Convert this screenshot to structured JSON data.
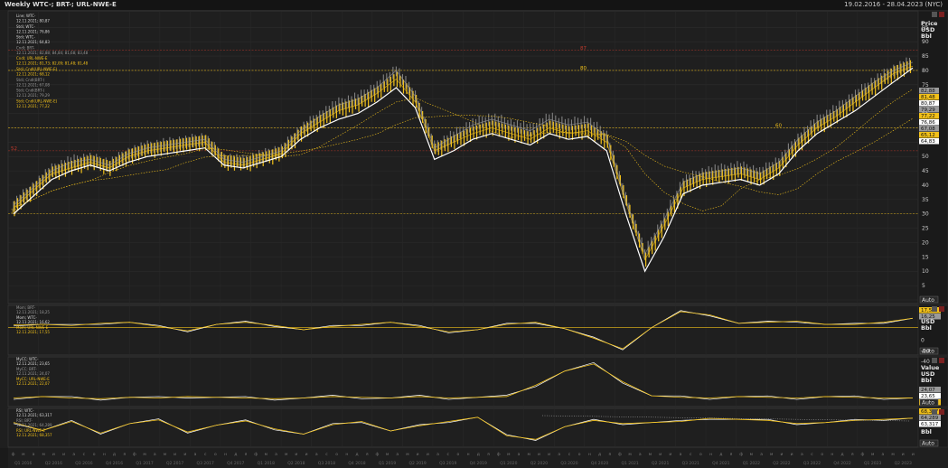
{
  "window": {
    "title": "Weekly WTC-; BRT-; URL-NWE-E",
    "date_range": "19.02.2016 - 28.04.2023 (NYC)"
  },
  "colors": {
    "white_series": "#ffffff",
    "yellow_series": "#f2c11a",
    "gray_series": "#9a9a9a",
    "red_line": "#c0392b",
    "bg": "#1f1f1f"
  },
  "toolbar": {
    "auto_label": "Auto",
    "close_icon": "close-icon",
    "settings_icon": "gear-icon"
  },
  "panels": {
    "price": {
      "header": [
        "Price",
        "USD",
        "Bbl"
      ],
      "legend": [
        {
          "name": "Line; WTC-",
          "date": "12.11.2021; 80,87",
          "color": "white"
        },
        {
          "name": "Stdi; WTC-",
          "date": "12.11.2021; 76,86",
          "color": "white"
        },
        {
          "name": "Stdi; WTC-",
          "date": "12.11.2021; 64,83",
          "color": "white"
        },
        {
          "name": "Cndl; BRT-",
          "date": "12.11.2021; 82,88; 84,84; 81,68; 83,48",
          "color": "gray"
        },
        {
          "name": "Cndl; URL-NWE-E",
          "date": "12.11.2021; 81,73; 82,09; 81,48; 81,48",
          "color": "yellow"
        },
        {
          "name": "Stdi; Cndl(URL-NWE-E)",
          "date": "12.11.2021; 68,12",
          "color": "yellow"
        },
        {
          "name": "Stdi; Cndl(BRT-)",
          "date": "12.11.2021; 67,08",
          "color": "gray"
        },
        {
          "name": "Stdi; Cndl(BRT-)",
          "date": "12.11.2021; 79,29",
          "color": "gray"
        },
        {
          "name": "Stdi; Cndl(URL-NWE-E)",
          "date": "12.11.2021; 77,22",
          "color": "yellow"
        }
      ],
      "ticks": [
        95,
        90,
        85,
        80,
        75,
        70,
        65,
        60,
        55,
        50,
        45,
        40,
        35,
        30,
        25,
        20,
        15,
        10,
        5,
        0
      ],
      "value_tags": [
        {
          "text": "82,88",
          "color": "gray"
        },
        {
          "text": "81,48",
          "color": "yellow"
        },
        {
          "text": "80,87",
          "color": "white"
        },
        {
          "text": "79,29",
          "color": "gray"
        },
        {
          "text": "77,22",
          "color": "yellow"
        },
        {
          "text": "76,86",
          "color": "white"
        },
        {
          "text": "67,08",
          "color": "gray"
        },
        {
          "text": "65,12",
          "color": "yellow"
        },
        {
          "text": "64,83",
          "color": "white"
        }
      ],
      "hlines": [
        {
          "value": 87,
          "label": "87",
          "color": "red"
        },
        {
          "value": 80,
          "label": "80",
          "color": "yellow"
        },
        {
          "value": 60,
          "label": "60",
          "color": "yellow"
        },
        {
          "value": 52,
          "label": "52",
          "color": "red"
        },
        {
          "value": 30,
          "label": "30",
          "color": "yellow"
        }
      ]
    },
    "mom": {
      "legend": [
        {
          "name": "Mom; BRT-",
          "date": "12.11.2021; 18,25",
          "color": "gray"
        },
        {
          "name": "Mom; WTC-",
          "date": "12.11.2021; 16,62",
          "color": "white"
        },
        {
          "name": "Mom; URL-NWE-E",
          "date": "12.11.2021; 17,55",
          "color": "yellow"
        }
      ],
      "header": [
        "USD",
        "Bbl"
      ],
      "ticks": [
        0,
        -20,
        -40
      ],
      "value_tags": [
        {
          "text": "17,55",
          "color": "yellow"
        },
        {
          "text": "16,25",
          "color": "gray"
        }
      ]
    },
    "mycc": {
      "legend": [
        {
          "name": "MyCC; WTC-",
          "date": "12.11.2021; 23,65",
          "color": "white"
        },
        {
          "name": "MyCC; BRT-",
          "date": "12.11.2021; 24,07",
          "color": "gray"
        },
        {
          "name": "MyCC; URL-NWE-E",
          "date": "12.11.2021; 22,07",
          "color": "yellow"
        }
      ],
      "header": [
        "Value",
        "USD",
        "Bbl"
      ],
      "value_tags": [
        {
          "text": "24,07",
          "color": "gray"
        },
        {
          "text": "23,65",
          "color": "white"
        },
        {
          "text": "22,07",
          "color": "yellow"
        }
      ]
    },
    "rsi": {
      "legend": [
        {
          "name": "RSI; WTC-",
          "date": "12.11.2021; 63,317",
          "color": "white"
        },
        {
          "name": "RSI; BRT-",
          "date": "12.11.2021; 64,289",
          "color": "gray"
        },
        {
          "name": "RSI; URL-NWE-E",
          "date": "12.11.2021; 68,357",
          "color": "yellow"
        }
      ],
      "header": [
        "Bbl"
      ],
      "value_tags": [
        {
          "text": "68,357",
          "color": "yellow"
        },
        {
          "text": "64,289",
          "color": "gray"
        },
        {
          "text": "63,317",
          "color": "white"
        }
      ]
    }
  },
  "xaxis": {
    "quarters": [
      "Q1 2016",
      "Q2 2016",
      "Q3 2016",
      "Q4 2016",
      "Q1 2017",
      "Q2 2017",
      "Q3 2017",
      "Q4 2017",
      "Q1 2018",
      "Q2 2018",
      "Q3 2018",
      "Q4 2018",
      "Q1 2019",
      "Q2 2019",
      "Q3 2019",
      "Q4 2019",
      "Q1 2020",
      "Q2 2020",
      "Q3 2020",
      "Q4 2020",
      "Q1 2021",
      "Q2 2021",
      "Q3 2021",
      "Q4 2021",
      "Q1 2022",
      "Q2 2022",
      "Q3 2022",
      "Q4 2022",
      "Q1 2023",
      "Q2 2023"
    ],
    "month_letters": [
      "ф",
      "м",
      "а",
      "м",
      "и",
      "и",
      "а",
      "с",
      "о",
      "н",
      "д",
      "я"
    ]
  },
  "chart_data": [
    {
      "type": "line",
      "panel": "price",
      "x_range": [
        "19.02.2016",
        "28.04.2023"
      ],
      "ylim": [
        0,
        97
      ],
      "series": [
        {
          "name": "Line; WTC-",
          "color": "#ffffff",
          "values": [
            30,
            36,
            42,
            45,
            47,
            45,
            48,
            50,
            51,
            52,
            53,
            47,
            46,
            48,
            50,
            56,
            60,
            63,
            65,
            69,
            74,
            67,
            49,
            52,
            56,
            58,
            56,
            54,
            58,
            56,
            57,
            52,
            30,
            10,
            22,
            37,
            40,
            41,
            42,
            40,
            44,
            52,
            58,
            62,
            66,
            71,
            76,
            80.87
          ]
        },
        {
          "name": "Cndl; URL-NWE-E",
          "color": "#f2c11a",
          "values": [
            32,
            38,
            44,
            46,
            48,
            46,
            50,
            52,
            53,
            54,
            55,
            48,
            47,
            49,
            51,
            58,
            62,
            66,
            68,
            72,
            77,
            69,
            52,
            55,
            58,
            60,
            58,
            56,
            60,
            58,
            59,
            55,
            34,
            14,
            26,
            39,
            42,
            43,
            44,
            42,
            46,
            54,
            60,
            64,
            69,
            74,
            79,
            81.48
          ]
        },
        {
          "name": "Cndl; BRT-",
          "color": "#9a9a9a",
          "values": [
            33,
            39,
            45,
            48,
            49,
            47,
            51,
            53,
            54,
            55,
            56,
            49,
            48,
            50,
            52,
            59,
            64,
            68,
            70,
            74,
            80,
            71,
            53,
            57,
            61,
            63,
            61,
            59,
            63,
            61,
            62,
            57,
            35,
            16,
            28,
            41,
            44,
            45,
            46,
            44,
            48,
            56,
            62,
            66,
            71,
            76,
            80,
            82.88
          ]
        }
      ]
    },
    {
      "type": "line",
      "panel": "mom",
      "series": [
        {
          "name": "Mom; URL-NWE-E",
          "values": [
            5,
            6,
            4,
            8,
            10,
            2,
            -6,
            6,
            10,
            4,
            -4,
            2,
            6,
            10,
            2,
            -8,
            -4,
            6,
            10,
            -2,
            -20,
            -40,
            0,
            30,
            24,
            8,
            10,
            12,
            6,
            6,
            10,
            17.55
          ]
        }
      ]
    },
    {
      "type": "line",
      "panel": "mycc",
      "series": [
        {
          "name": "MyCC; URL-NWE-E",
          "values": [
            22,
            24,
            22,
            21,
            23,
            22,
            24,
            23,
            22,
            21,
            22,
            24,
            23,
            22,
            24,
            22,
            23,
            24,
            40,
            60,
            70,
            45,
            25,
            23,
            22,
            24,
            23,
            22,
            24,
            23,
            22,
            22.07
          ]
        }
      ]
    },
    {
      "type": "line",
      "panel": "rsi",
      "series": [
        {
          "name": "RSI; URL-NWE-E",
          "values": [
            60,
            45,
            62,
            40,
            58,
            65,
            42,
            55,
            63,
            48,
            38,
            56,
            62,
            44,
            54,
            62,
            70,
            35,
            28,
            52,
            64,
            58,
            60,
            62,
            68,
            66,
            64,
            58,
            60,
            64,
            66,
            68.357
          ]
        }
      ]
    }
  ]
}
